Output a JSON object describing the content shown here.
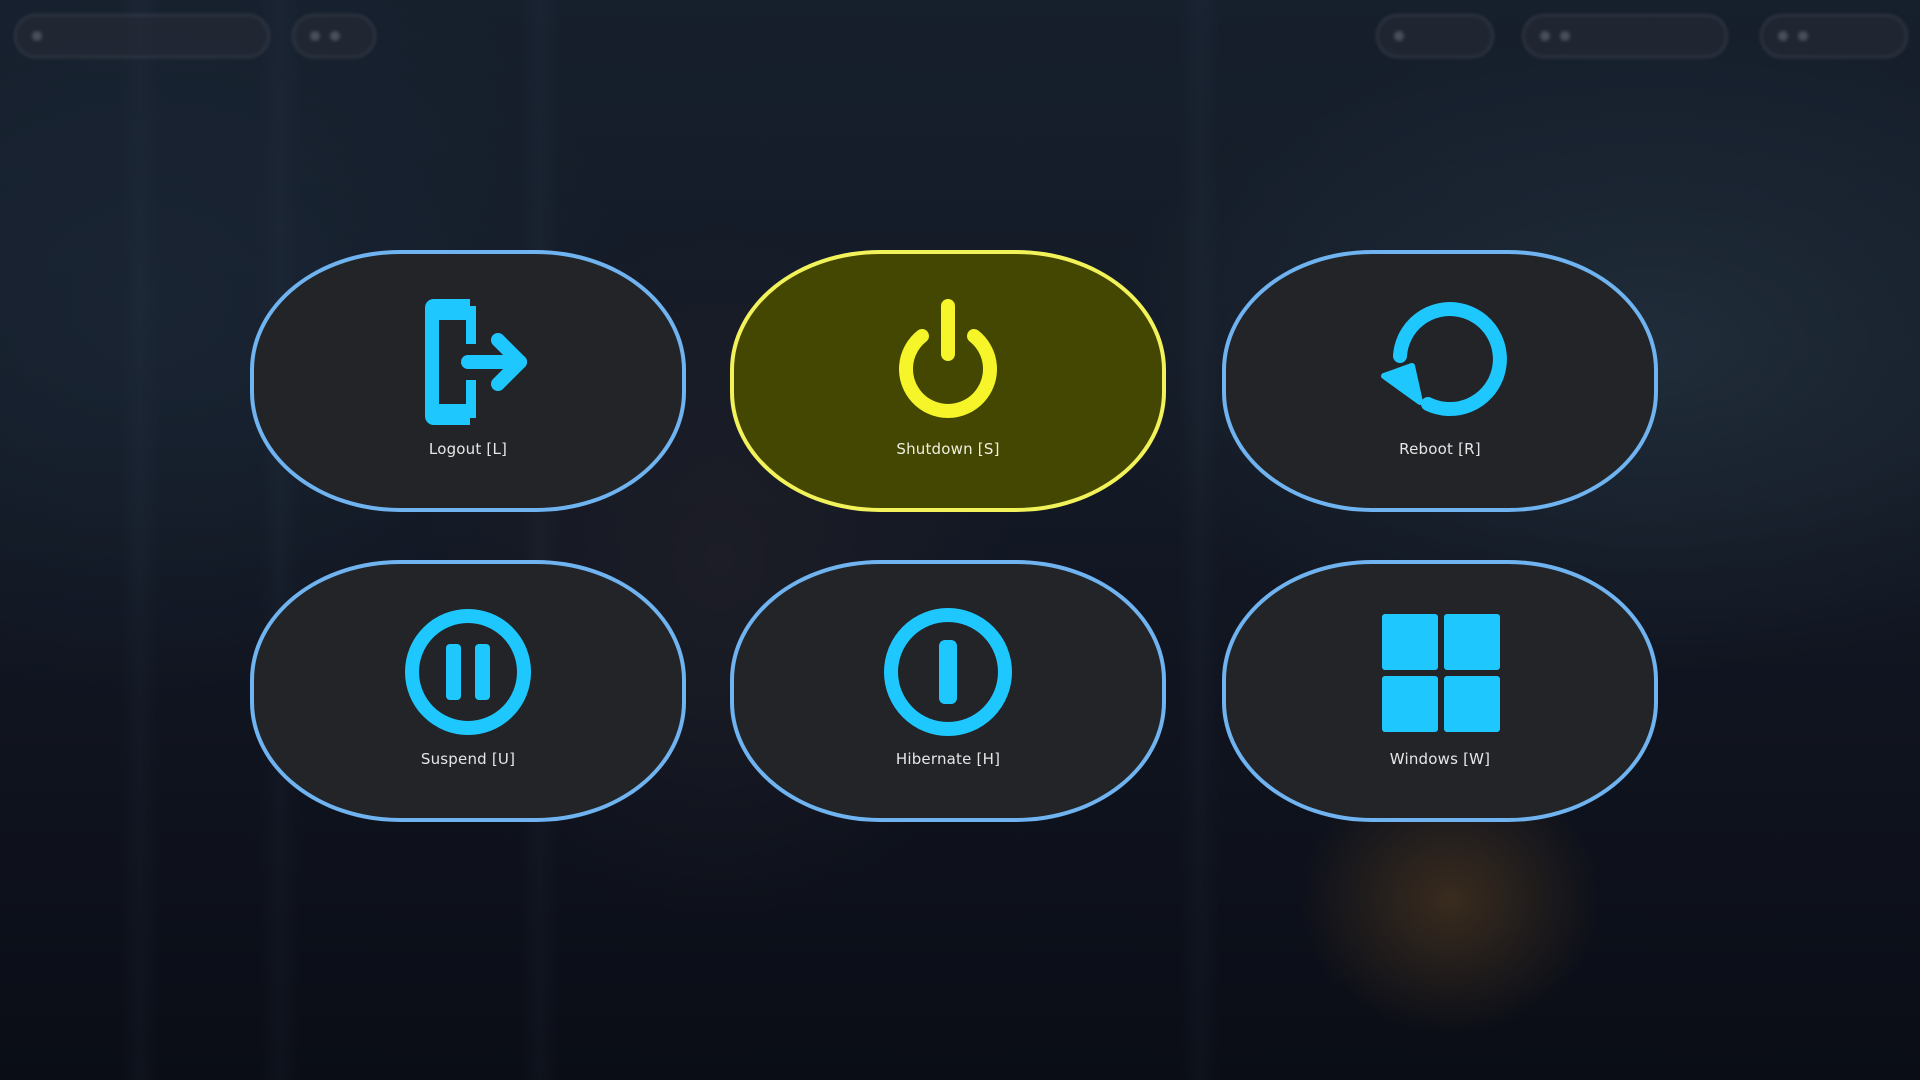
{
  "colors": {
    "accent": "#1ec8ff",
    "tile_border": "#6fb3f0",
    "tile_bg": "#222428",
    "selected_bg": "#444701",
    "selected_border": "#f2f25a",
    "selected_icon": "#f5f52a"
  },
  "power_menu": {
    "selected": "shutdown",
    "options": [
      {
        "id": "logout",
        "label": "Logout [L]",
        "icon": "logout-icon"
      },
      {
        "id": "shutdown",
        "label": "Shutdown [S]",
        "icon": "power-icon"
      },
      {
        "id": "reboot",
        "label": "Reboot [R]",
        "icon": "reboot-icon"
      },
      {
        "id": "suspend",
        "label": "Suspend [U]",
        "icon": "pause-icon"
      },
      {
        "id": "hibernate",
        "label": "Hibernate [H]",
        "icon": "hibernate-icon"
      },
      {
        "id": "windows",
        "label": "Windows [W]",
        "icon": "windows-icon"
      }
    ]
  }
}
